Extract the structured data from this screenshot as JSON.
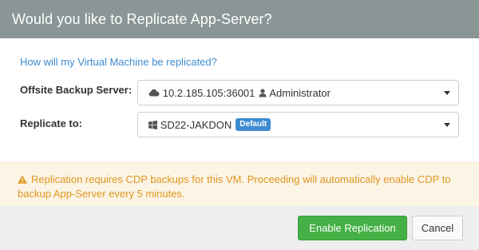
{
  "dialog": {
    "title": "Would you like to Replicate App-Server?",
    "question_link": "How will my Virtual Machine be replicated?",
    "offsite_label": "Offsite Backup Server:",
    "offsite_value": "10.2.185.105:36001",
    "offsite_user": "Administrator",
    "replicate_label": "Replicate to:",
    "replicate_value": "SD22-JAKDON",
    "replicate_badge": "Default",
    "warning": "Replication requires CDP backups for this VM. Proceeding will automatically enable CDP to backup App-Server every 5 minutes.",
    "enable_button": "Enable Replication",
    "cancel_button": "Cancel"
  },
  "icons": {
    "server": "cloud-icon",
    "user": "user-icon",
    "target": "windows-icon",
    "warning": "warning-icon"
  },
  "colors": {
    "header": "#8a9696",
    "link": "#3d8bd1",
    "warning_text": "#e09722",
    "warning_bg": "#fcf4e5",
    "primary_button": "#45b045",
    "badge": "#3d8bd1"
  }
}
